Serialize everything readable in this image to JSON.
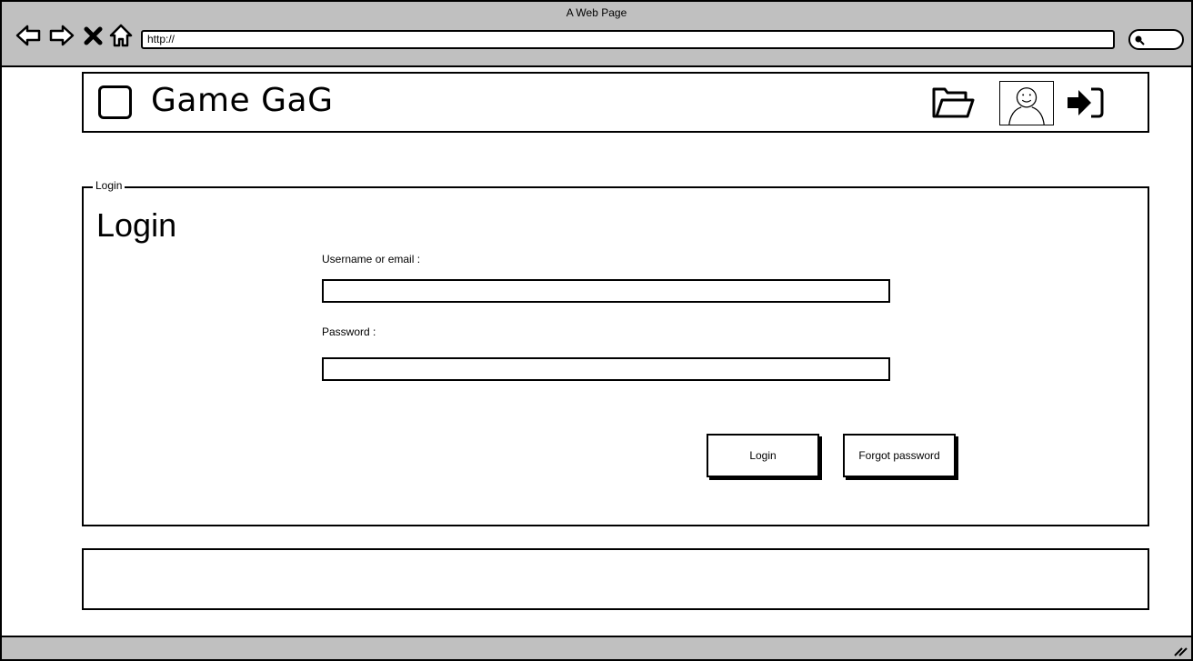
{
  "browser": {
    "title": "A Web Page",
    "url": "http://",
    "icons": [
      "back-arrow-icon",
      "forward-arrow-icon",
      "close-x-icon",
      "home-icon",
      "search-icon"
    ]
  },
  "header": {
    "site_title": "Game GaG",
    "icons": [
      "logo-placeholder",
      "folder-open-icon",
      "user-avatar",
      "sign-in-icon"
    ]
  },
  "login": {
    "legend": "Login",
    "title": "Login",
    "username_label": "Username or email :",
    "username_value": "",
    "password_label": "Password :",
    "password_value": "",
    "login_button": "Login",
    "forgot_button": "Forgot password"
  },
  "colors": {
    "chrome_bg": "#c0c0c0",
    "stroke": "#000000",
    "page_bg": "#ffffff"
  }
}
